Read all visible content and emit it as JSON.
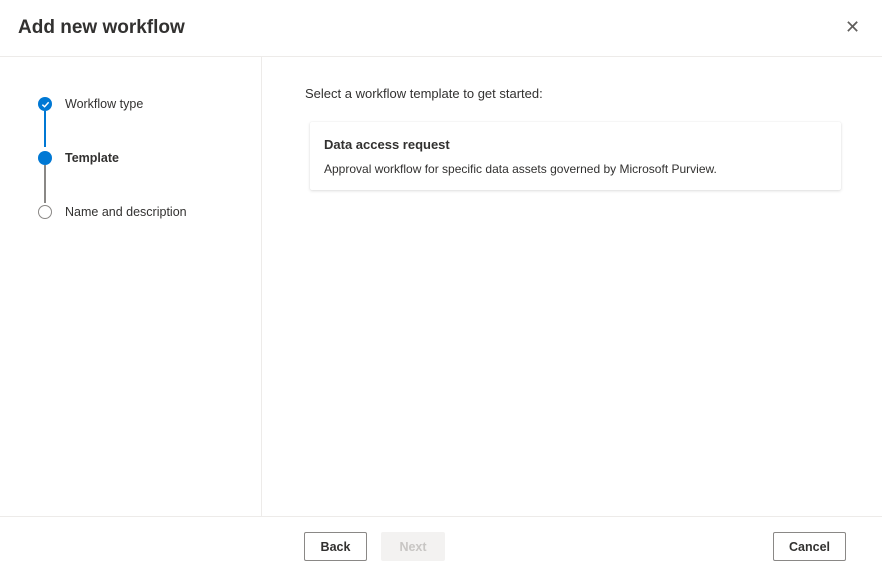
{
  "dialog": {
    "title": "Add new workflow",
    "close_icon": "close-icon"
  },
  "steps": [
    {
      "label": "Workflow type",
      "state": "completed"
    },
    {
      "label": "Template",
      "state": "current"
    },
    {
      "label": "Name and description",
      "state": "pending"
    }
  ],
  "main": {
    "prompt": "Select a workflow template to get started:",
    "templates": [
      {
        "title": "Data access request",
        "description": "Approval workflow for specific data assets governed by Microsoft Purview."
      }
    ]
  },
  "footer": {
    "back_label": "Back",
    "next_label": "Next",
    "cancel_label": "Cancel"
  },
  "colors": {
    "accent": "#0078d4",
    "pending": "#8a8886"
  }
}
